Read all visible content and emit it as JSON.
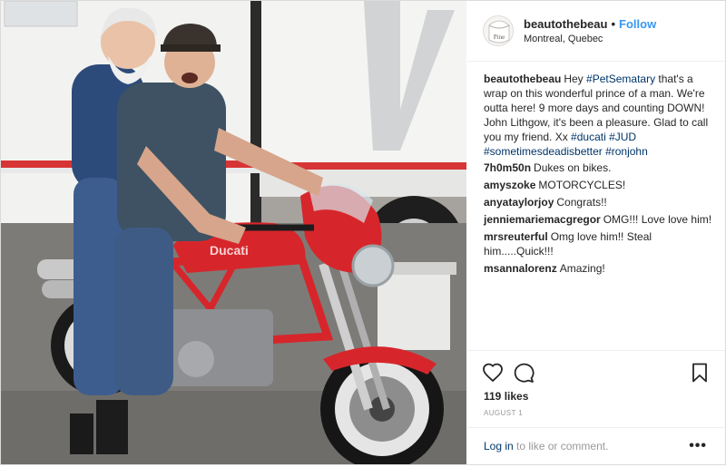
{
  "post": {
    "username": "beautothebeau",
    "follow_label": "Follow",
    "location": "Montreal, Quebec",
    "avatar_text": "Pine"
  },
  "caption": {
    "username": "beautothebeau",
    "text_1": "Hey ",
    "tag_1": "#PetSematary",
    "text_2": " that's a wrap on this wonderful prince of a man. We're outta here! 9 more days and counting DOWN! John Lithgow, it's been a pleasure. Glad to call you my friend. Xx ",
    "tag_2": "#ducati",
    "tag_3": "#JUD",
    "tag_4": "#sometimesdeadisbetter",
    "tag_5": "#ronjohn"
  },
  "comments": [
    {
      "user": "7h0m50n",
      "text": "Dukes on bikes."
    },
    {
      "user": "amyszoke",
      "text": "MOTORCYCLES!"
    },
    {
      "user": "anyataylorjoy",
      "text": "Congrats!!"
    },
    {
      "user": "jenniemariemacgregor",
      "text": "OMG!!! Love love him!"
    },
    {
      "user": "mrsreuterful",
      "text": "Omg love him!! Steal him.....Quick!!!"
    },
    {
      "user": "msannalorenz",
      "text": "Amazing!"
    }
  ],
  "stats": {
    "likes": "119 likes",
    "date": "AUGUST 1"
  },
  "footer": {
    "login_link": "Log in",
    "login_rest": " to like or comment.",
    "more_label": "•••"
  },
  "icons": {
    "like": "heart-icon",
    "comment": "comment-icon",
    "save": "bookmark-icon",
    "more": "more-options-icon"
  },
  "colors": {
    "link_blue": "#3897f0",
    "hashtag": "#003569",
    "bike_red": "#d7262b",
    "muted": "#999999"
  }
}
